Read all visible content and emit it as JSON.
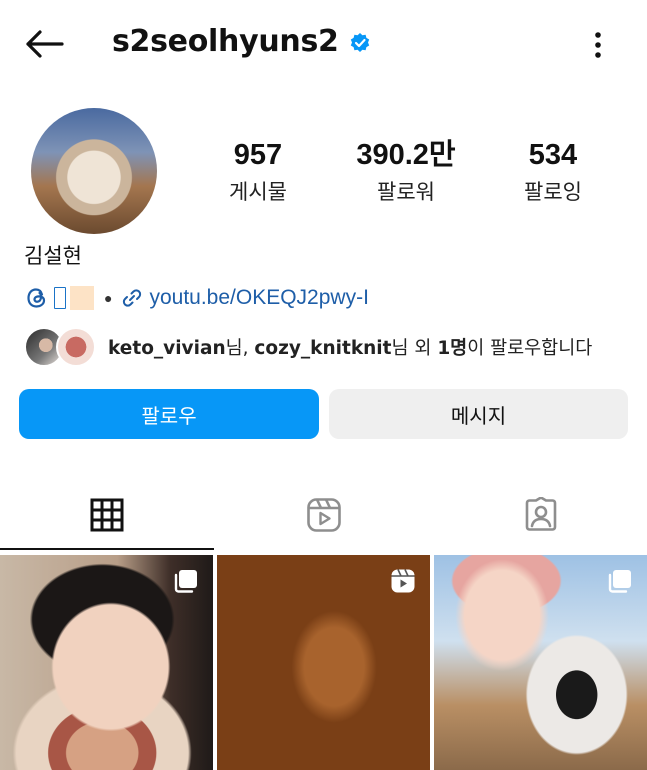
{
  "header": {
    "username": "s2seolhyuns2",
    "verified_icon": "verified-badge-icon",
    "back_icon": "arrow-left-icon",
    "more_icon": "more-vertical-icon"
  },
  "profile": {
    "full_name": "김설현",
    "stats": {
      "posts": {
        "count": "957",
        "label": "게시물"
      },
      "followers": {
        "count": "390.2만",
        "label": "팔로워"
      },
      "following": {
        "count": "534",
        "label": "팔로잉"
      }
    },
    "link_text": "youtu.be/OKEQJ2pwy-I",
    "mutual": {
      "user1": "keto_vivian",
      "sep1": "님, ",
      "user2": "cozy_knitknit",
      "mid": "님 외 ",
      "count": "1명",
      "tail": "이 팔로우합니다"
    }
  },
  "actions": {
    "follow_label": "팔로우",
    "message_label": "메시지"
  },
  "tabs": [
    "grid-icon",
    "reels-icon",
    "tagged-icon"
  ],
  "colors": {
    "follow_button": "#0797f7",
    "message_button": "#efefef",
    "link": "#1e5ea8",
    "verified": "#0797f7"
  }
}
